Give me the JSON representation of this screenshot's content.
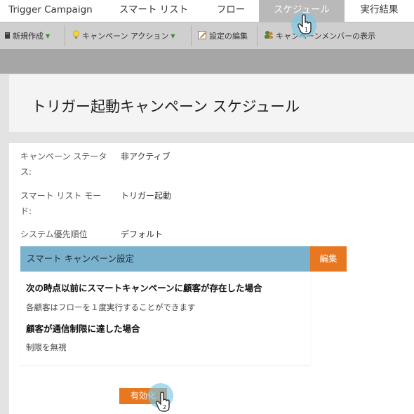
{
  "tabs": [
    {
      "label": "Trigger Campaign",
      "active": false
    },
    {
      "label": "スマート リスト",
      "active": false
    },
    {
      "label": "フロー",
      "active": false
    },
    {
      "label": "スケジュール",
      "active": true
    },
    {
      "label": "実行結果",
      "active": false
    }
  ],
  "toolbar": {
    "new_label": "新規作成",
    "campaign_action_label": "キャンペーン アクション",
    "edit_settings_label": "設定の編集",
    "view_members_label": "キャンペーンメンバーの表示"
  },
  "header": {
    "title": "トリガー起動キャンペーン スケジュール"
  },
  "fields": [
    {
      "label_line1": "キャンペーン ステータ",
      "label_line2": "ス:",
      "value": "非アクティブ"
    },
    {
      "label_line1": "スマート リスト モー",
      "label_line2": "ド:",
      "value": "トリガー起動"
    },
    {
      "label_line1": "システム優先順位",
      "label_line2": "",
      "value": "デフォルト"
    }
  ],
  "settings": {
    "title": "スマート キャンペーン設定",
    "edit_label": "編集",
    "rule1_heading": "次の時点以前にスマートキャンペーンに顧客が存在した場合",
    "rule1_text": "各顧客はフローを１度実行することができます",
    "rule2_heading": "顧客が通信制限に達した場合",
    "rule2_text": "制限を無視"
  },
  "activate_label": "有効化",
  "callouts": [
    "1",
    "2"
  ],
  "colors": {
    "accent_orange": "#e87722",
    "settings_header_blue": "#7ab1cd",
    "active_tab_grey": "#b9b9b9"
  },
  "icons": [
    "new-document-icon",
    "lightbulb-icon",
    "edit-settings-icon",
    "members-icon",
    "pointer-hand-icon"
  ]
}
